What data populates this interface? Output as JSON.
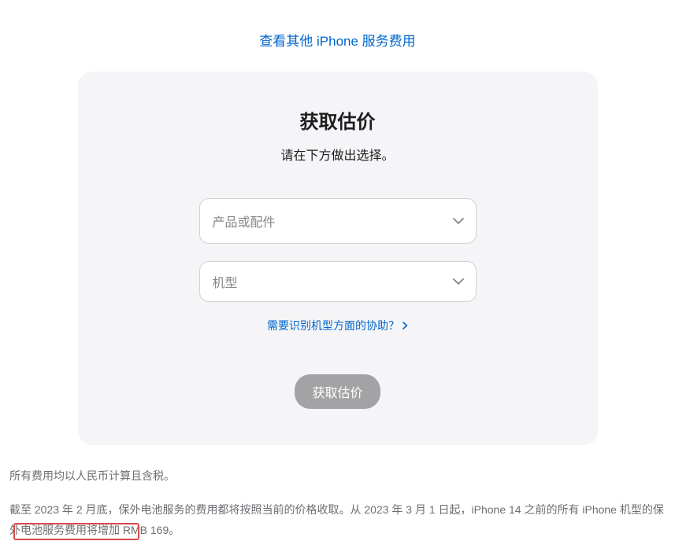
{
  "topLink": {
    "label": "查看其他 iPhone 服务费用"
  },
  "card": {
    "title": "获取估价",
    "subtitle": "请在下方做出选择。",
    "select1": {
      "placeholder": "产品或配件"
    },
    "select2": {
      "placeholder": "机型"
    },
    "helpLink": {
      "label": "需要识别机型方面的协助？"
    },
    "button": {
      "label": "获取估价"
    }
  },
  "footer": {
    "line1": "所有费用均以人民币计算且含税。",
    "line2": "截至 2023 年 2 月底，保外电池服务的费用都将按照当前的价格收取。从 2023 年 3 月 1 日起，iPhone 14 之前的所有 iPhone 机型的保外电池服务费用将增加 RMB 169。"
  }
}
